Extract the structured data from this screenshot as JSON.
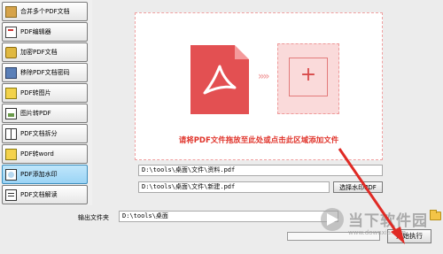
{
  "sidebar": {
    "items": [
      {
        "label": "合并多个PDF文档",
        "icon": "merge-icon"
      },
      {
        "label": "PDF编辑器",
        "icon": "pdf-editor-icon"
      },
      {
        "label": "加密PDF文档",
        "icon": "lock-icon"
      },
      {
        "label": "移除PDF文档密码",
        "icon": "unlock-icon"
      },
      {
        "label": "PDF转图片",
        "icon": "pdf-to-image-icon"
      },
      {
        "label": "图片转PDF",
        "icon": "image-to-pdf-icon"
      },
      {
        "label": "PDF文档拆分",
        "icon": "split-icon"
      },
      {
        "label": "PDF转word",
        "icon": "word-icon"
      },
      {
        "label": "PDF添加水印",
        "icon": "watermark-icon",
        "active": true
      },
      {
        "label": "PDF文档解读",
        "icon": "read-icon"
      }
    ]
  },
  "drop_zone": {
    "hint": "请将PDF文件拖放至此处或点击此区域添加文件"
  },
  "files": {
    "file1_path": "D:\\tools\\桌面\\文件\\资料.pdf",
    "file2_path": "D:\\tools\\桌面\\文件\\新建.pdf",
    "select_watermark_button": "选择水印PDF"
  },
  "output": {
    "label": "输出文件夹",
    "path": "D:\\tools\\桌面"
  },
  "progress_fraction": 0,
  "start_button": "开始执行",
  "watermark": {
    "text": "当下软件园",
    "url": "www.downxia.com"
  },
  "colors": {
    "accent_red": "#e0342b",
    "active_item_bg": "#9bd4f5",
    "pdf_icon": "#e35052"
  }
}
